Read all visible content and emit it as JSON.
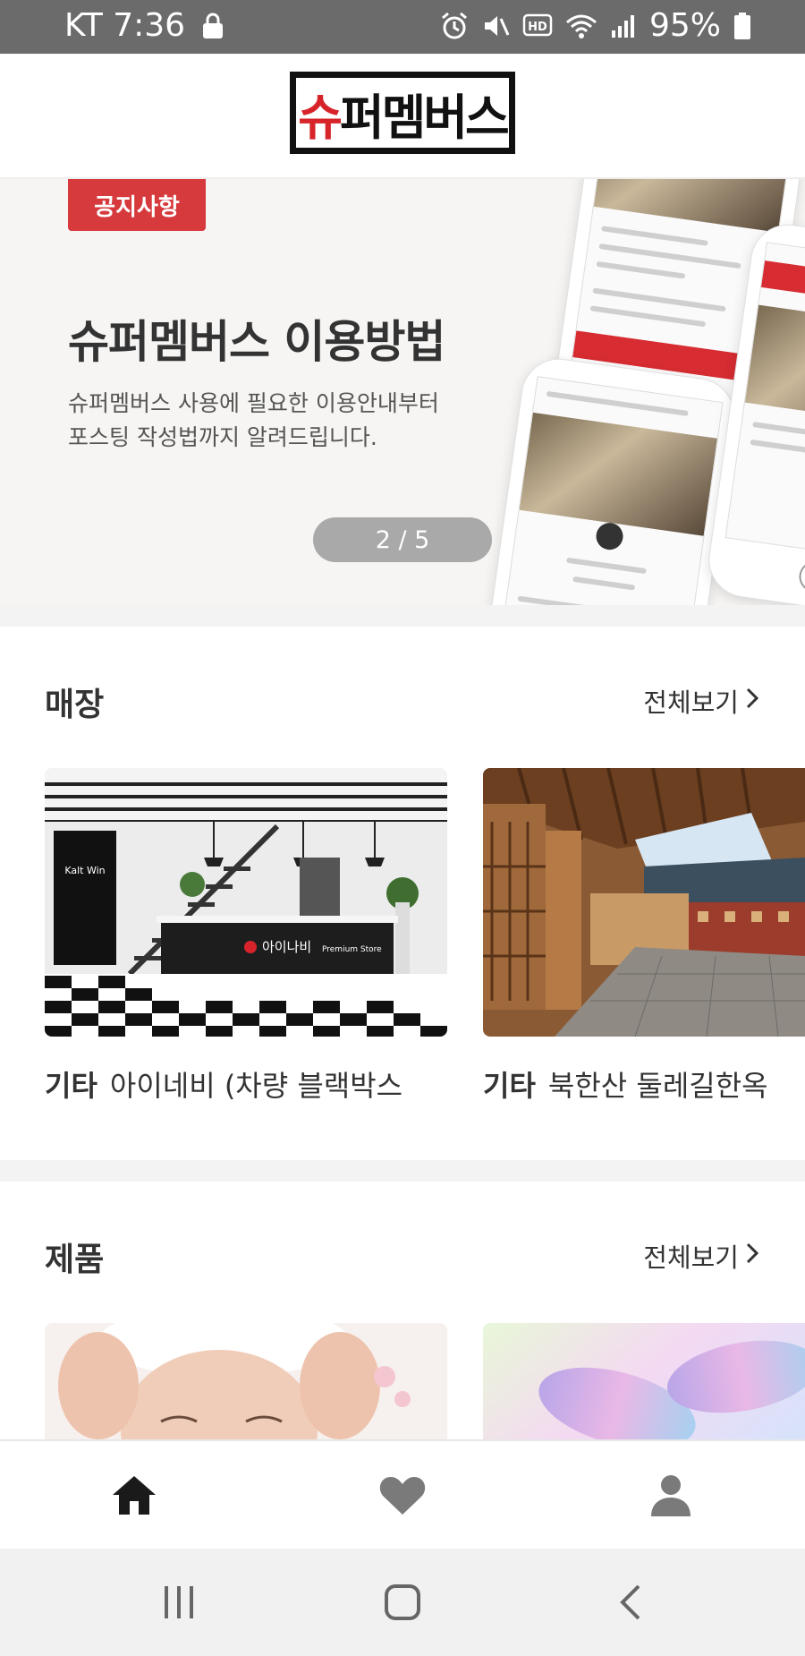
{
  "status_bar": {
    "carrier_time": "KT 7:36",
    "battery": "95%",
    "icons": [
      "lock-icon",
      "alarm-icon",
      "mute-icon",
      "hd-icon",
      "wifi-icon",
      "signal-icon",
      "battery-icon"
    ]
  },
  "header": {
    "logo_text": "슈퍼멤버스"
  },
  "banner": {
    "badge": "공지사항",
    "title": "슈퍼멤버스 이용방법",
    "description": "슈퍼멤버스 사용에 필요한 이용안내부터 포스팅 작성법까지 알려드립니다.",
    "pager": "2 / 5"
  },
  "stores": {
    "title": "매장",
    "see_all": "전체보기",
    "items": [
      {
        "category": "기타",
        "name": "아이네비 (차량 블랙박스"
      },
      {
        "category": "기타",
        "name": "북한산 둘레길한옥"
      }
    ]
  },
  "products": {
    "title": "제품",
    "see_all": "전체보기"
  },
  "bottom_nav": {
    "items": [
      "home-icon",
      "heart-icon",
      "person-icon"
    ]
  },
  "colors": {
    "accent_red": "#d63a3d",
    "status_bar": "#6b6b6b"
  }
}
